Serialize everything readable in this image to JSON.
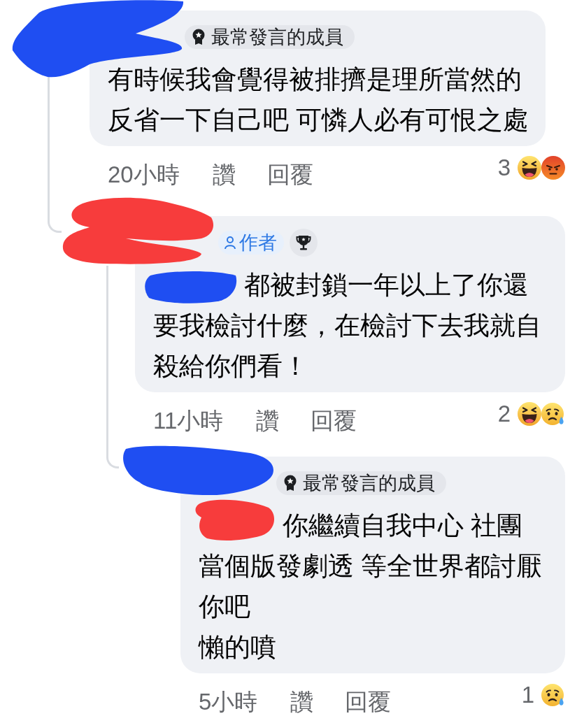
{
  "comments": [
    {
      "redactions": [
        {
          "kind": "name",
          "color": "#1f4ef2"
        }
      ],
      "badges": [
        {
          "kind": "top_contributor",
          "label": "最常發言的成員"
        }
      ],
      "body": [
        "有時候我會覺得被排擠是理所當然的",
        "反省一下自己吧 可憐人必有可恨之處"
      ],
      "time": "20小時",
      "like": "讚",
      "reply": "回覆",
      "reaction_count": "3",
      "reactions": [
        {
          "kind": "haha"
        },
        {
          "kind": "angry"
        }
      ],
      "replies": [
        {
          "redactions": [
            {
              "kind": "name",
              "color": "#f73c3c"
            },
            {
              "kind": "body",
              "color": "#1f4ef2"
            }
          ],
          "badges": [
            {
              "kind": "author",
              "label": "作者"
            },
            {
              "kind": "trophy"
            }
          ],
          "body": [
            "都被封鎖一年以上了你還",
            "要我檢討什麼，在檢討下去我就自",
            "殺給你們看！"
          ],
          "time": "11小時",
          "like": "讚",
          "reply": "回覆",
          "reaction_count": "2",
          "reactions": [
            {
              "kind": "haha"
            },
            {
              "kind": "sad"
            }
          ],
          "replies": [
            {
              "redactions": [
                {
                  "kind": "name",
                  "color": "#1f4ef2"
                },
                {
                  "kind": "body",
                  "color": "#f73c3c"
                }
              ],
              "badges": [
                {
                  "kind": "top_contributor",
                  "label": "最常發言的成員"
                }
              ],
              "body": [
                "你繼續自我中心 社團",
                "當個版發劇透 等全世界都討厭",
                "你吧",
                "懶的噴"
              ],
              "time": "5小時",
              "like": "讚",
              "reply": "回覆",
              "reaction_count": "1",
              "reactions": [
                {
                  "kind": "sad"
                }
              ]
            }
          ]
        }
      ]
    }
  ]
}
